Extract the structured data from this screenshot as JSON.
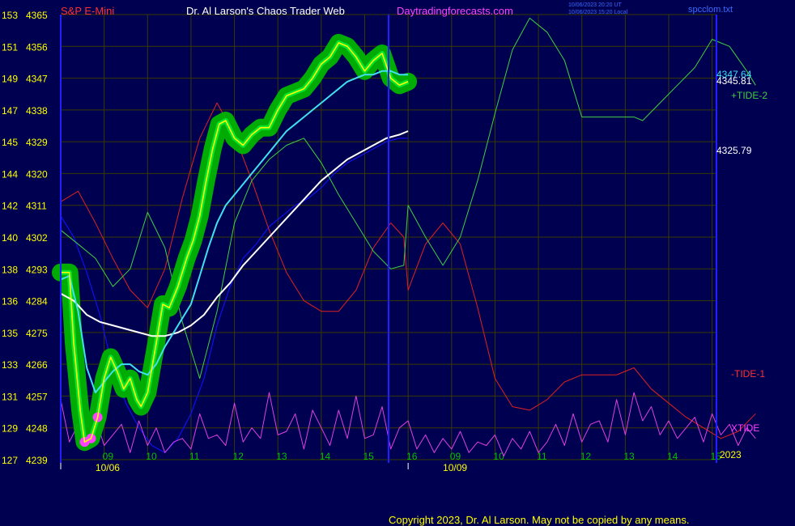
{
  "header": {
    "instrument": "S&P E-Mini",
    "title": "Dr. Al Larson's Chaos Trader Web",
    "site": "Daytradingforecasts.com",
    "stamp_line1": "10/06/2023 20:20 UT",
    "stamp_line2": "10/06/2023 15:20 Local",
    "file": "spcclom.txt"
  },
  "footer": {
    "copyright": "Copyright 2023, Dr. Al Larson. May not be copied by any means.",
    "year": "2023"
  },
  "colors": {
    "background": "#000050",
    "grid": "#3a3a00",
    "axis": "#2020ff",
    "price": "#ffff00",
    "glow": "#00b400",
    "ma_cyan": "#40e0f0",
    "ma_white": "#ffffff",
    "ma_blue": "#1010ee",
    "tide2": "#40d040",
    "tide1": "#e02020",
    "xtide": "#e040e0",
    "label_yellow": "#ffff00",
    "label_red": "#ff3030",
    "title_white": "#ffffff",
    "site_magenta": "#ff40ff",
    "hour_green": "#00c000"
  },
  "chart_data": {
    "type": "line",
    "y_axis": {
      "range": [
        4239,
        4365
      ],
      "ticks": [
        {
          "price": 4365,
          "index": "153"
        },
        {
          "price": 4356,
          "index": "151"
        },
        {
          "price": 4347,
          "index": "149"
        },
        {
          "price": 4338,
          "index": "147"
        },
        {
          "price": 4329,
          "index": "145"
        },
        {
          "price": 4320,
          "index": "144"
        },
        {
          "price": 4311,
          "index": "142"
        },
        {
          "price": 4302,
          "index": "140"
        },
        {
          "price": 4293,
          "index": "138"
        },
        {
          "price": 4284,
          "index": "136"
        },
        {
          "price": 4275,
          "index": "135"
        },
        {
          "price": 4266,
          "index": "133"
        },
        {
          "price": 4257,
          "index": "131"
        },
        {
          "price": 4248,
          "index": "129"
        },
        {
          "price": 4239,
          "index": "127"
        }
      ]
    },
    "x_axis": {
      "range": [
        8.0,
        23.1
      ],
      "hour_ticks": [
        {
          "x": 9,
          "label": "09"
        },
        {
          "x": 10,
          "label": "10"
        },
        {
          "x": 11,
          "label": "11"
        },
        {
          "x": 12,
          "label": "12"
        },
        {
          "x": 13,
          "label": "13"
        },
        {
          "x": 14,
          "label": "14"
        },
        {
          "x": 15,
          "label": "15"
        },
        {
          "x": 16,
          "label": "16"
        },
        {
          "x": 17,
          "label": "09"
        },
        {
          "x": 18,
          "label": "10"
        },
        {
          "x": 19,
          "label": "11"
        },
        {
          "x": 20,
          "label": "12"
        },
        {
          "x": 21,
          "label": "13"
        },
        {
          "x": 22,
          "label": "14"
        },
        {
          "x": 23,
          "label": "15"
        },
        {
          "x": 24,
          "label": "16"
        }
      ],
      "day_labels": [
        {
          "x": 8.8,
          "label": "10/06"
        },
        {
          "x": 16.8,
          "label": "10/09"
        }
      ],
      "session_break": 16.0
    },
    "series": [
      {
        "key": "price",
        "x": [
          8.0,
          8.2,
          8.3,
          8.45,
          8.55,
          8.7,
          8.85,
          9.0,
          9.15,
          9.3,
          9.45,
          9.6,
          9.75,
          9.85,
          10.0,
          10.2,
          10.35,
          10.5,
          10.7,
          10.9,
          11.05,
          11.2,
          11.35,
          11.5,
          11.65,
          11.8,
          12.0,
          12.2,
          12.4,
          12.6,
          12.8,
          13.0,
          13.2,
          13.4,
          13.6,
          13.8,
          14.0,
          14.2,
          14.4,
          14.6,
          14.8,
          15.0,
          15.2,
          15.4,
          15.6,
          15.8,
          16.0
        ],
        "values": [
          4292,
          4292,
          4272,
          4253,
          4244,
          4245,
          4251,
          4262,
          4268,
          4264,
          4259,
          4262,
          4256,
          4254,
          4258,
          4272,
          4283,
          4282,
          4288,
          4296,
          4301,
          4308,
          4318,
          4327,
          4334,
          4335,
          4330,
          4328,
          4331,
          4333,
          4333,
          4338,
          4342,
          4343,
          4344,
          4347,
          4351,
          4353,
          4357,
          4356,
          4353,
          4349,
          4352,
          4354,
          4347,
          4345,
          4346
        ]
      },
      {
        "key": "ma_cyan",
        "x": [
          8.0,
          8.2,
          8.4,
          8.6,
          8.8,
          9.0,
          9.2,
          9.4,
          9.6,
          9.8,
          10.0,
          10.2,
          10.4,
          10.6,
          10.8,
          11.0,
          11.2,
          11.4,
          11.6,
          11.8,
          12.0,
          12.2,
          12.4,
          12.6,
          12.8,
          13.0,
          13.2,
          13.4,
          13.6,
          13.8,
          14.0,
          14.2,
          14.4,
          14.6,
          14.8,
          15.0,
          15.2,
          15.4,
          15.6,
          15.8,
          16.0
        ],
        "values": [
          4290,
          4291,
          4281,
          4265,
          4258,
          4261,
          4264,
          4266,
          4266,
          4264,
          4263,
          4266,
          4271,
          4275,
          4279,
          4283,
          4291,
          4299,
          4306,
          4311,
          4314,
          4317,
          4320,
          4323,
          4326,
          4329,
          4332,
          4334,
          4336,
          4338,
          4340,
          4342,
          4344,
          4346,
          4347,
          4348,
          4348,
          4349,
          4349,
          4348,
          4348
        ]
      },
      {
        "key": "ma_white",
        "x": [
          8.0,
          8.3,
          8.6,
          8.9,
          9.2,
          9.5,
          9.8,
          10.1,
          10.4,
          10.7,
          11.0,
          11.3,
          11.6,
          11.9,
          12.2,
          12.5,
          12.8,
          13.1,
          13.4,
          13.7,
          14.0,
          14.3,
          14.6,
          14.9,
          15.2,
          15.5,
          15.8,
          16.0
        ],
        "values": [
          4286,
          4284,
          4280,
          4278,
          4277,
          4276,
          4275,
          4274,
          4274,
          4275,
          4277,
          4280,
          4285,
          4289,
          4294,
          4298,
          4302,
          4306,
          4310,
          4314,
          4318,
          4321,
          4324,
          4326,
          4328,
          4330,
          4331,
          4332
        ]
      },
      {
        "key": "ma_blue",
        "x": [
          8.0,
          8.3,
          8.6,
          8.9,
          9.2,
          9.5,
          9.8,
          10.1,
          10.4,
          10.7,
          11.0,
          11.3,
          11.6,
          11.9,
          12.2,
          12.5,
          12.8,
          13.1,
          13.4,
          13.7,
          14.0,
          14.3,
          14.6,
          14.9,
          15.2,
          15.5,
          15.8,
          16.0
        ],
        "values": [
          4308,
          4302,
          4292,
          4280,
          4265,
          4255,
          4248,
          4243,
          4241,
          4245,
          4252,
          4262,
          4277,
          4288,
          4296,
          4300,
          4305,
          4308,
          4311,
          4313,
          4316,
          4320,
          4323,
          4325,
          4327,
          4329,
          4330,
          4330
        ]
      },
      {
        "key": "tide2",
        "label": "+TIDE-2",
        "x": [
          8.0,
          8.4,
          8.8,
          9.2,
          9.6,
          10.0,
          10.4,
          10.8,
          11.2,
          11.6,
          12.0,
          12.4,
          12.8,
          13.2,
          13.6,
          14.0,
          14.4,
          14.8,
          15.2,
          15.6,
          15.9,
          16.0,
          16.4,
          16.8,
          17.2,
          17.6,
          18.0,
          18.4,
          18.8,
          19.2,
          19.6,
          20.0,
          20.4,
          20.8,
          21.2,
          21.4,
          21.8,
          22.2,
          22.6,
          23.0,
          23.4,
          23.8,
          24.0
        ],
        "values": [
          4304,
          4300,
          4296,
          4288,
          4293,
          4309,
          4299,
          4278,
          4262,
          4281,
          4306,
          4318,
          4324,
          4328,
          4330,
          4323,
          4314,
          4306,
          4298,
          4293,
          4294,
          4311,
          4302,
          4294,
          4302,
          4318,
          4337,
          4355,
          4364,
          4360,
          4352,
          4336,
          4336,
          4336,
          4336,
          4335,
          4340,
          4345,
          4350,
          4358,
          4356,
          4349,
          4345
        ]
      },
      {
        "key": "tide1",
        "label": "-TIDE-1",
        "x": [
          8.0,
          8.4,
          8.8,
          9.2,
          9.6,
          10.0,
          10.4,
          10.8,
          11.2,
          11.6,
          12.0,
          12.4,
          12.8,
          13.2,
          13.6,
          14.0,
          14.4,
          14.8,
          15.2,
          15.6,
          15.9,
          16.0,
          16.4,
          16.8,
          17.2,
          17.6,
          18.0,
          18.4,
          18.8,
          19.2,
          19.6,
          20.0,
          20.4,
          20.8,
          21.2,
          21.6,
          22.0,
          22.4,
          22.8,
          23.2,
          23.6,
          24.0
        ],
        "values": [
          4312,
          4315,
          4306,
          4296,
          4287,
          4282,
          4293,
          4313,
          4330,
          4340,
          4331,
          4318,
          4304,
          4292,
          4284,
          4281,
          4281,
          4287,
          4299,
          4306,
          4302,
          4287,
          4300,
          4306,
          4300,
          4282,
          4262,
          4254,
          4253,
          4256,
          4261,
          4263,
          4263,
          4263,
          4265,
          4259,
          4255,
          4251,
          4248,
          4245,
          4247,
          4252
        ]
      },
      {
        "key": "xtide",
        "label": "XTIDE",
        "x": [
          8.0,
          8.2,
          8.4,
          8.6,
          8.8,
          9.0,
          9.2,
          9.4,
          9.6,
          9.8,
          10.0,
          10.2,
          10.4,
          10.6,
          10.8,
          11.0,
          11.2,
          11.4,
          11.6,
          11.8,
          12.0,
          12.2,
          12.4,
          12.6,
          12.8,
          13.0,
          13.2,
          13.4,
          13.6,
          13.8,
          14.0,
          14.2,
          14.4,
          14.6,
          14.8,
          15.0,
          15.2,
          15.4,
          15.6,
          15.8,
          16.0,
          16.2,
          16.4,
          16.6,
          16.8,
          17.0,
          17.2,
          17.4,
          17.6,
          17.8,
          18.0,
          18.2,
          18.4,
          18.6,
          18.8,
          19.0,
          19.2,
          19.4,
          19.6,
          19.8,
          20.0,
          20.2,
          20.4,
          20.6,
          20.8,
          21.0,
          21.2,
          21.4,
          21.6,
          21.8,
          22.0,
          22.2,
          22.4,
          22.6,
          22.8,
          23.0,
          23.2,
          23.4,
          23.6,
          23.8,
          24.0
        ],
        "values": [
          4256,
          4244,
          4249,
          4243,
          4251,
          4243,
          4246,
          4249,
          4241,
          4250,
          4243,
          4248,
          4241,
          4244,
          4245,
          4242,
          4252,
          4245,
          4246,
          4243,
          4255,
          4244,
          4248,
          4245,
          4258,
          4246,
          4247,
          4252,
          4242,
          4253,
          4248,
          4243,
          4253,
          4245,
          4257,
          4245,
          4246,
          4254,
          4242,
          4248,
          4250,
          4242,
          4246,
          4241,
          4245,
          4242,
          4247,
          4241,
          4244,
          4243,
          4246,
          4240,
          4245,
          4242,
          4247,
          4241,
          4244,
          4249,
          4243,
          4252,
          4244,
          4249,
          4250,
          4244,
          4256,
          4246,
          4258,
          4250,
          4254,
          4246,
          4250,
          4245,
          4248,
          4251,
          4244,
          4252,
          4246,
          4249,
          4243,
          4248,
          4245
        ]
      }
    ],
    "right_labels": {
      "last_price_a": "4347.64",
      "last_price_b": "4345.81",
      "level_white": "4325.79",
      "tide2": "+TIDE-2",
      "tide1": "-TIDE-1",
      "xtide": "XTIDE"
    },
    "grid": true
  }
}
